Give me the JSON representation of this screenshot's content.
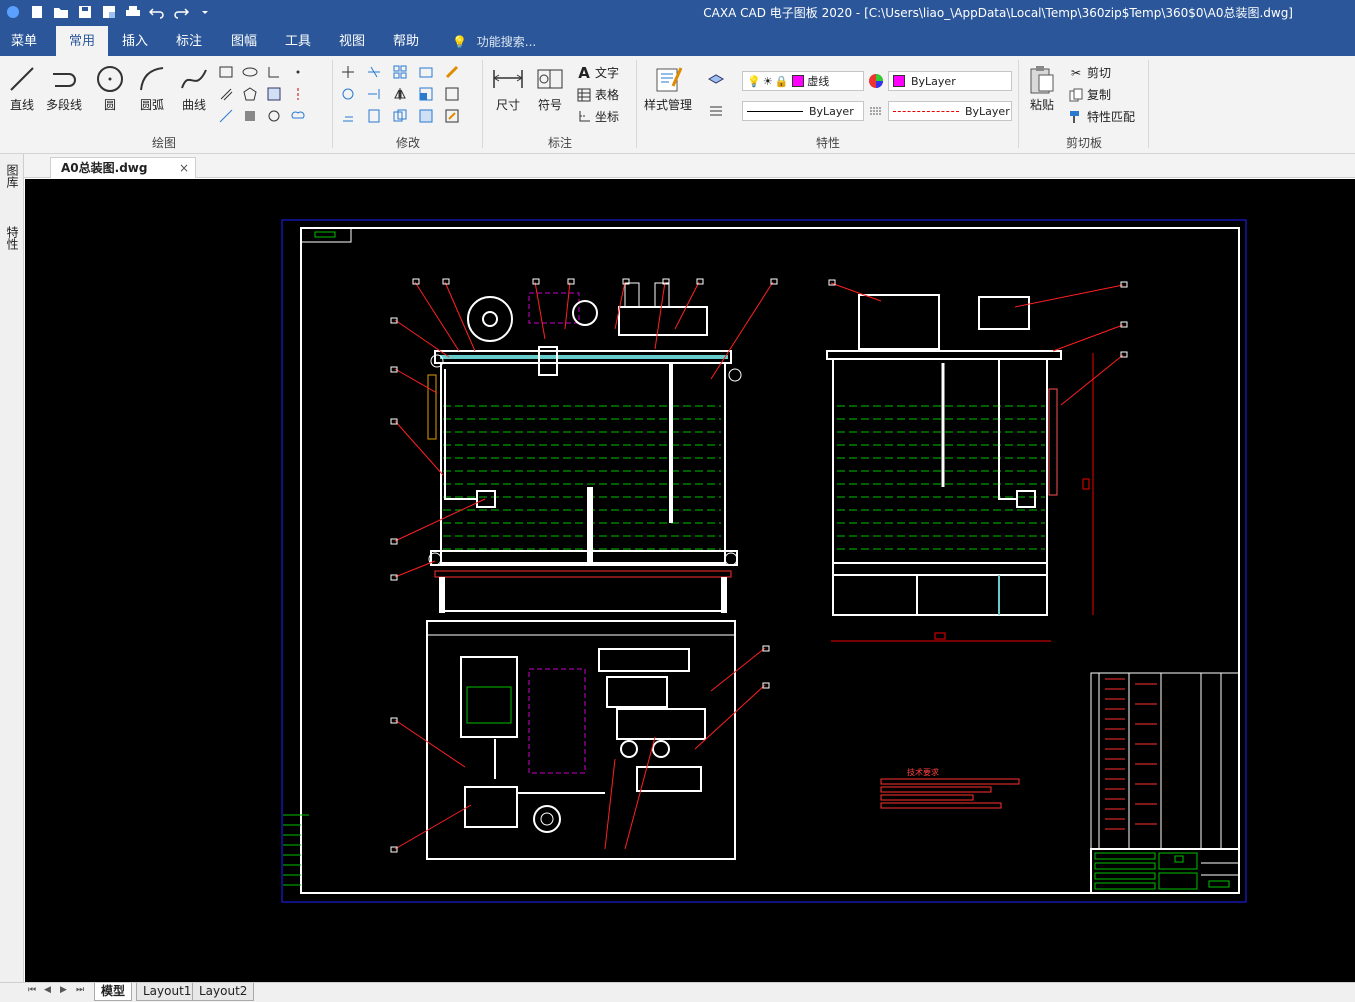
{
  "window": {
    "title": "CAXA CAD 电子图板 2020 - [C:\\Users\\liao_\\AppData\\Local\\Temp\\360zip$Temp\\360$0\\A0总装图.dwg]"
  },
  "menubar": {
    "items": [
      "菜单",
      "常用",
      "插入",
      "标注",
      "图幅",
      "工具",
      "视图",
      "帮助"
    ],
    "active": "常用",
    "search_placeholder": "功能搜索..."
  },
  "ribbon": {
    "draw": {
      "label": "绘图",
      "buttons": [
        "直线",
        "多段线",
        "圆",
        "圆弧",
        "曲线"
      ]
    },
    "modify": {
      "label": "修改"
    },
    "annotate": {
      "label": "标注",
      "buttons": [
        "尺寸",
        "符号"
      ],
      "small": [
        "文字",
        "表格",
        "坐标"
      ]
    },
    "properties": {
      "label": "特性",
      "style_button": "样式管理",
      "layer_value": "虚线",
      "color_value": "ByLayer",
      "linetype_value": "ByLayer",
      "lineweight_value": "ByLayer"
    },
    "clipboard": {
      "label": "剪切板",
      "paste": "粘贴",
      "small": [
        "剪切",
        "复制",
        "特性匹配"
      ]
    }
  },
  "document": {
    "tab_label": "A0总装图.dwg",
    "close_glyph": "×"
  },
  "left_panel": {
    "tabs": [
      "图库",
      "特性"
    ]
  },
  "drawing": {
    "tech_req_title": "技术要求"
  },
  "layout_tabs": {
    "tabs": [
      "模型",
      "Layout1",
      "Layout2"
    ],
    "active": "模型"
  },
  "colors": {
    "titlebar": "#2b579a",
    "canvas": "#000000",
    "drawing_white": "#ffffff",
    "leader_red": "#e00000",
    "fluid_green": "#00c000",
    "hidden_magenta": "#cc00cc",
    "frame_blue": "#0000ff"
  }
}
